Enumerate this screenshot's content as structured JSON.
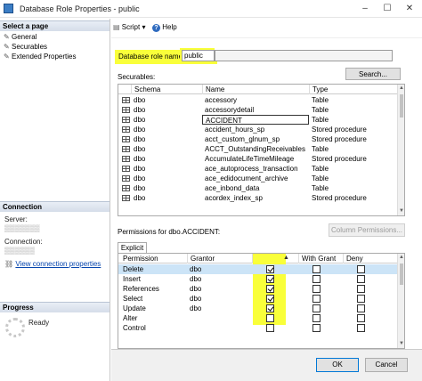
{
  "window": {
    "title": "Database Role Properties - public",
    "minimize": "–",
    "restore": "☐",
    "close": "✕"
  },
  "left": {
    "select_page_header": "Select a page",
    "pages": [
      {
        "label": "General"
      },
      {
        "label": "Securables"
      },
      {
        "label": "Extended Properties"
      }
    ],
    "connection_header": "Connection",
    "server_label": "Server:",
    "server_value": "▒▒▒▒▒▒▒",
    "connection_label": "Connection:",
    "connection_value": "▒▒▒▒▒▒",
    "view_link": "View connection properties",
    "progress_header": "Progress",
    "progress_status": "Ready"
  },
  "toolbar": {
    "script_label": "Script",
    "help_label": "Help"
  },
  "role": {
    "name_label": "Database role name:",
    "name_value": "public"
  },
  "securables": {
    "label": "Securables:",
    "search_button": "Search...",
    "columns": [
      "Schema",
      "Name",
      "Type"
    ],
    "rows": [
      {
        "schema": "dbo",
        "name": "accessory",
        "type": "Table"
      },
      {
        "schema": "dbo",
        "name": "accessorydetail",
        "type": "Table"
      },
      {
        "schema": "dbo",
        "name": "ACCIDENT",
        "type": "Table"
      },
      {
        "schema": "dbo",
        "name": "accident_hours_sp",
        "type": "Stored procedure"
      },
      {
        "schema": "dbo",
        "name": "acct_custom_glnum_sp",
        "type": "Stored procedure"
      },
      {
        "schema": "dbo",
        "name": "ACCT_OutstandingReceivables",
        "type": "Table"
      },
      {
        "schema": "dbo",
        "name": "AccumulateLifeTimeMileage",
        "type": "Stored procedure"
      },
      {
        "schema": "dbo",
        "name": "ace_autoprocess_transaction",
        "type": "Table"
      },
      {
        "schema": "dbo",
        "name": "ace_edidocument_archive",
        "type": "Table"
      },
      {
        "schema": "dbo",
        "name": "ace_inbond_data",
        "type": "Table"
      },
      {
        "schema": "dbo",
        "name": "acordex_index_sp",
        "type": "Stored procedure"
      }
    ]
  },
  "permissions": {
    "label": "Permissions for dbo.ACCIDENT:",
    "column_permissions_button": "Column Permissions...",
    "tab_explicit": "Explicit",
    "columns": [
      "Permission",
      "Grantor",
      "Grant",
      "With Grant",
      "Deny"
    ],
    "rows": [
      {
        "permission": "Delete",
        "grantor": "dbo",
        "grant": true,
        "with_grant": false,
        "deny": false
      },
      {
        "permission": "Insert",
        "grantor": "dbo",
        "grant": true,
        "with_grant": false,
        "deny": false
      },
      {
        "permission": "References",
        "grantor": "dbo",
        "grant": true,
        "with_grant": false,
        "deny": false
      },
      {
        "permission": "Select",
        "grantor": "dbo",
        "grant": true,
        "with_grant": false,
        "deny": false
      },
      {
        "permission": "Update",
        "grantor": "dbo",
        "grant": true,
        "with_grant": false,
        "deny": false
      },
      {
        "permission": "Alter",
        "grantor": "",
        "grant": false,
        "with_grant": false,
        "deny": false
      },
      {
        "permission": "Control",
        "grantor": "",
        "grant": false,
        "with_grant": false,
        "deny": false
      }
    ]
  },
  "footer": {
    "ok": "OK",
    "cancel": "Cancel"
  },
  "colors": {
    "highlight": "#f9ff3a",
    "selection": "#cce4f7",
    "link": "#0645ad"
  }
}
